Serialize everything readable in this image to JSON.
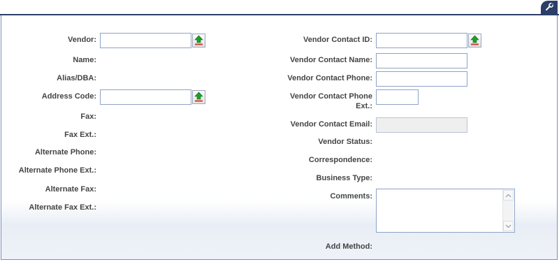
{
  "left": {
    "vendor_label": "Vendor:",
    "vendor_value": "",
    "name_label": "Name:",
    "alias_label": "Alias/DBA:",
    "address_code_label": "Address Code:",
    "address_code_value": "",
    "fax_label": "Fax:",
    "fax_ext_label": "Fax Ext.:",
    "alt_phone_label": "Alternate Phone:",
    "alt_phone_ext_label": "Alternate Phone Ext.:",
    "alt_fax_label": "Alternate Fax:",
    "alt_fax_ext_label": "Alternate Fax Ext.:"
  },
  "right": {
    "contact_id_label": "Vendor Contact ID:",
    "contact_id_value": "",
    "contact_name_label": "Vendor Contact Name:",
    "contact_name_value": "",
    "contact_phone_label": "Vendor Contact Phone:",
    "contact_phone_value": "",
    "contact_phone_ext_label_1": "Vendor Contact Phone",
    "contact_phone_ext_label_2": "Ext.:",
    "contact_phone_ext_value": "",
    "contact_email_label": "Vendor Contact Email:",
    "contact_email_value": "",
    "status_label": "Vendor Status:",
    "correspondence_label": "Correspondence:",
    "business_type_label": "Business Type:",
    "comments_label": "Comments:",
    "comments_value": "",
    "add_method_label": "Add Method:"
  },
  "icons": {
    "lookup": "lookup-arrow-icon",
    "tools": "wrench-icon"
  },
  "colors": {
    "header": "#2b3e68",
    "input_border": "#8ea2c6",
    "lookup_arrow": "#1f9e2a"
  }
}
